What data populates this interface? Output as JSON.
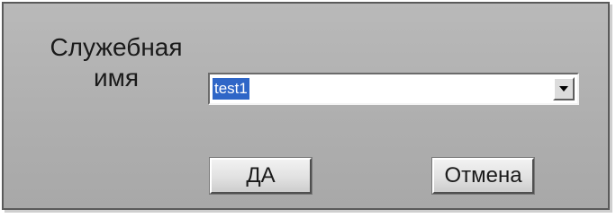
{
  "dialog": {
    "label_line1": "Служебная",
    "label_line2": "имя",
    "combo": {
      "value": "test1",
      "dropdown_icon": "chevron-down-icon"
    },
    "ok_label": "ДА",
    "cancel_label": "Отмена"
  }
}
